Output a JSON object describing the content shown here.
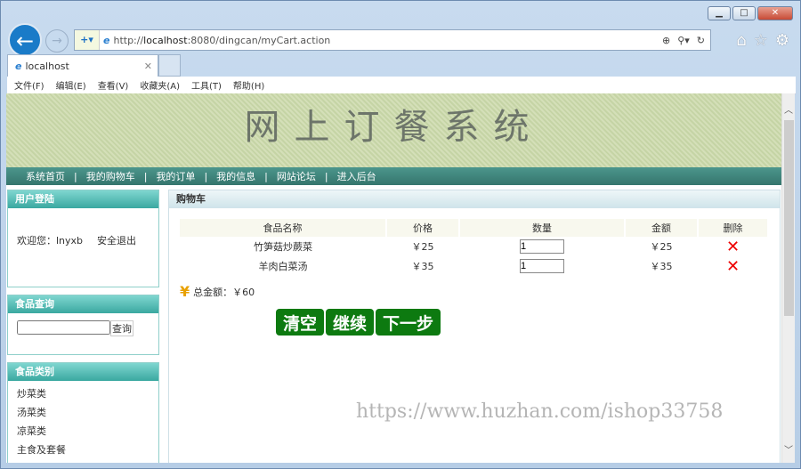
{
  "browser": {
    "url_prefix": "http://",
    "url_host": "localhost",
    "url_rest": ":8080/dingcan/myCart.action",
    "tab_title": "localhost",
    "menu": [
      "文件(F)",
      "编辑(E)",
      "查看(V)",
      "收藏夹(A)",
      "工具(T)",
      "帮助(H)"
    ]
  },
  "site": {
    "title": "网上订餐系统",
    "nav": [
      "系统首页",
      "我的购物车",
      "我的订单",
      "我的信息",
      "网站论坛",
      "进入后台"
    ]
  },
  "login": {
    "title": "用户登陆",
    "welcome": "欢迎您：",
    "user": "lnyxb",
    "logout": "安全退出"
  },
  "search": {
    "title": "食品查询",
    "button": "查询",
    "value": ""
  },
  "categories": {
    "title": "食品类别",
    "items": [
      "炒菜类",
      "汤菜类",
      "凉菜类",
      "主食及套餐"
    ]
  },
  "cart": {
    "title": "购物车",
    "headers": [
      "食品名称",
      "价格",
      "数量",
      "金额",
      "删除"
    ],
    "rows": [
      {
        "name": "竹笋菇炒蕨菜",
        "price": "￥25",
        "qty": "1",
        "amount": "￥25"
      },
      {
        "name": "羊肉白菜汤",
        "price": "￥35",
        "qty": "1",
        "amount": "￥35"
      }
    ],
    "total_label": "总金额：￥60",
    "buttons": [
      "清空",
      "继续",
      "下一步"
    ]
  },
  "watermark": "https://www.huzhan.com/ishop33758"
}
